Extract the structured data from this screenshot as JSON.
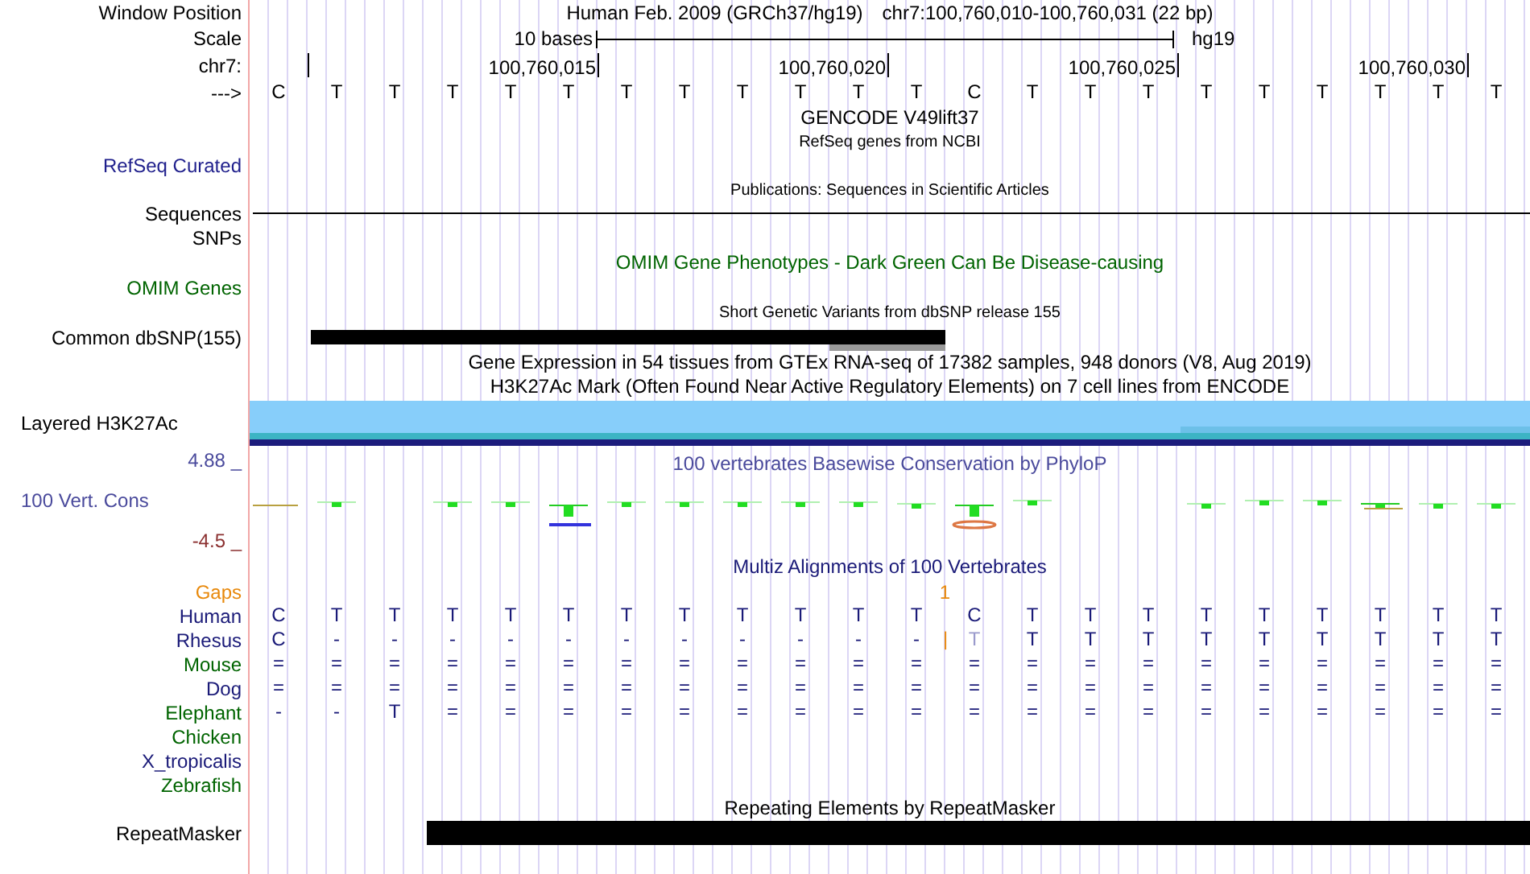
{
  "header": {
    "position_label": "Window Position",
    "assembly": "Human Feb. 2009 (GRCh37/hg19)",
    "position": "chr7:100,760,010-100,760,031 (22 bp)",
    "scale_label": "Scale",
    "scale_text": "10 bases",
    "scale_db": "hg19",
    "chrom_label": "chr7:",
    "tick_labels": [
      "100,760,015",
      "100,760,020",
      "100,760,025",
      "100,760,030"
    ],
    "strand_label": "--->",
    "bases": [
      "C",
      "T",
      "T",
      "T",
      "T",
      "T",
      "T",
      "T",
      "T",
      "T",
      "T",
      "T",
      "C",
      "T",
      "T",
      "T",
      "T",
      "T",
      "T",
      "T",
      "T",
      "T"
    ]
  },
  "rows": [
    {
      "kind": "title",
      "text": "GENCODE V49lift37"
    },
    {
      "kind": "small_title",
      "text": "RefSeq genes from NCBI"
    },
    {
      "kind": "label",
      "label": "RefSeq Curated",
      "color": "#1f1f8c"
    },
    {
      "kind": "small_title",
      "text": "Publications: Sequences in Scientific Articles"
    },
    {
      "kind": "sequences",
      "label": "Sequences"
    },
    {
      "kind": "label",
      "label": "SNPs",
      "color": "#000000"
    },
    {
      "kind": "title",
      "text": "OMIM Gene Phenotypes - Dark Green Can Be Disease-causing",
      "color": "#006400"
    },
    {
      "kind": "label",
      "label": "OMIM Genes",
      "color": "#006400"
    },
    {
      "kind": "small_title",
      "text": "Short Genetic Variants from dbSNP release 155"
    },
    {
      "kind": "dbsnp",
      "label": "Common dbSNP(155)"
    },
    {
      "kind": "title",
      "text": "Gene Expression in 54 tissues from GTEx RNA-seq of 17382 samples, 948 donors (V8, Aug 2019)"
    },
    {
      "kind": "title",
      "text": "H3K27Ac Mark (Often Found Near Active Regulatory Elements) on 7 cell lines from ENCODE"
    },
    {
      "kind": "signal",
      "label": "Layered H3K27Ac"
    },
    {
      "kind": "conservation",
      "label": "100 Vert. Cons",
      "max": "4.88 _",
      "min": "-4.5 _",
      "title": "100 vertebrates Basewise Conservation by PhyloP"
    },
    {
      "kind": "title",
      "text": "Multiz Alignments of 100 Vertebrates",
      "color": "#1a1a78"
    },
    {
      "kind": "gaps",
      "label": "Gaps",
      "text": "1",
      "color": "#e8890c"
    },
    {
      "kind": "species",
      "label": "Human",
      "color": "#1a1a78",
      "cells": [
        "C",
        "T",
        "T",
        "T",
        "T",
        "T",
        "T",
        "T",
        "T",
        "T",
        "T",
        "T",
        "C",
        "T",
        "T",
        "T",
        "T",
        "T",
        "T",
        "T",
        "T",
        "T"
      ]
    },
    {
      "kind": "species",
      "label": "Rhesus",
      "color": "#1a1a78",
      "cells": [
        "C",
        "-",
        "-",
        "-",
        "-",
        "-",
        "-",
        "-",
        "-",
        "-",
        "-",
        "-",
        {
          "kind": "gap",
          "text": "|"
        },
        {
          "kind": "faded",
          "text": "T"
        },
        "T",
        "T",
        "T",
        "T",
        "T",
        "T",
        "T",
        "T",
        "T"
      ]
    },
    {
      "kind": "species",
      "label": "Mouse",
      "color": "#006400",
      "cells": [
        "=",
        "=",
        "=",
        "=",
        "=",
        "=",
        "=",
        "=",
        "=",
        "=",
        "=",
        "=",
        "=",
        "=",
        "=",
        "=",
        "=",
        "=",
        "=",
        "=",
        "=",
        "="
      ]
    },
    {
      "kind": "species",
      "label": "Dog",
      "color": "#1a1a78",
      "cells": [
        "=",
        "=",
        "=",
        "=",
        "=",
        "=",
        "=",
        "=",
        "=",
        "=",
        "=",
        "=",
        "=",
        "=",
        "=",
        "=",
        "=",
        "=",
        "=",
        "=",
        "=",
        "="
      ]
    },
    {
      "kind": "species",
      "label": "Elephant",
      "color": "#006400",
      "cells": [
        "-",
        "-",
        "T",
        "=",
        "=",
        "=",
        "=",
        "=",
        "=",
        "=",
        "=",
        "=",
        "=",
        "=",
        "=",
        "=",
        "=",
        "=",
        "=",
        "=",
        "=",
        "="
      ]
    },
    {
      "kind": "species",
      "label": "Chicken",
      "color": "#006400"
    },
    {
      "kind": "species",
      "label": "X_tropicalis",
      "color": "#1a1a78"
    },
    {
      "kind": "species",
      "label": "Zebrafish",
      "color": "#006400"
    },
    {
      "kind": "title",
      "text": "Repeating Elements by RepeatMasker"
    },
    {
      "kind": "repeat",
      "label": "RepeatMasker"
    }
  ]
}
